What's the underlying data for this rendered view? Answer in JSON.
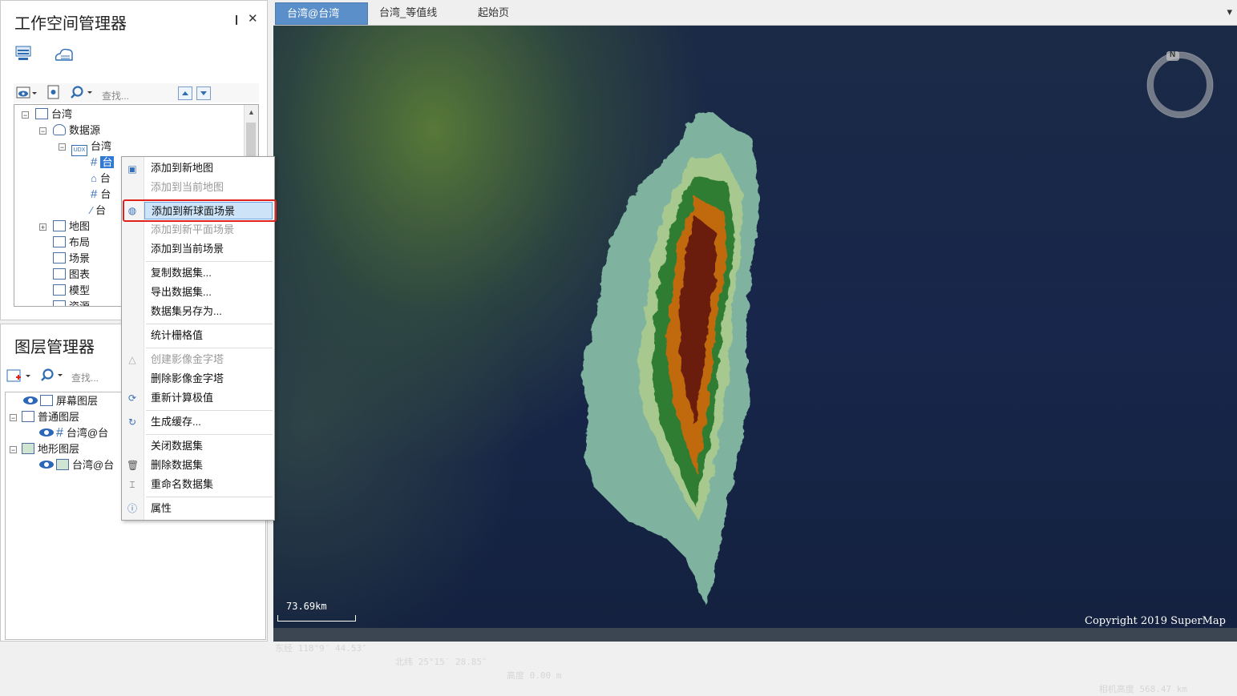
{
  "workspace_panel": {
    "title": "工作空间管理器",
    "pin_glyph": "❙",
    "close_glyph": "✕",
    "search_placeholder": "查找...",
    "tree": {
      "root": "台湾",
      "datasources": "数据源",
      "datasource_name": "台湾",
      "datasource_badge": "UDX",
      "datasets": [
        "台",
        "台",
        "台",
        "台"
      ],
      "groups": [
        "地图",
        "布局",
        "场景",
        "图表",
        "模型",
        "资源"
      ]
    }
  },
  "layer_panel": {
    "title": "图层管理器",
    "search_placeholder": "查找...",
    "tree": {
      "screen_layers": "屏幕图层",
      "normal_layers": "普通图层",
      "normal_child": "台湾@台",
      "terrain_layers": "地形图层",
      "terrain_child": "台湾@台"
    }
  },
  "tabs": [
    {
      "label": "台湾@台湾",
      "close": "✕"
    },
    {
      "label": "台湾_等值线"
    },
    {
      "label": "起始页"
    }
  ],
  "tab_dropdown": "▾",
  "scene": {
    "scale_label": "73.69km",
    "copyright": "Copyright 2019 SuperMap",
    "compass_letter": "N"
  },
  "status_bar": {
    "longitude": "东经 118°9′ 44.53″",
    "latitude": "北纬 25°15′ 28.85″",
    "altitude": "高度 0.00 m",
    "camera_height": "相机高度 568.47 km"
  },
  "context_menu": {
    "items": [
      {
        "label": "添加到新地图",
        "enabled": true
      },
      {
        "label": "添加到当前地图",
        "enabled": false
      },
      {
        "label": "添加到新球面场景",
        "enabled": true,
        "highlighted": true
      },
      {
        "label": "添加到新平面场景",
        "enabled": false
      },
      {
        "label": "添加到当前场景",
        "enabled": true
      },
      {
        "label": "复制数据集...",
        "enabled": true
      },
      {
        "label": "导出数据集...",
        "enabled": true
      },
      {
        "label": "数据集另存为...",
        "enabled": true
      },
      {
        "label": "统计栅格值",
        "enabled": true
      },
      {
        "label": "创建影像金字塔",
        "enabled": false
      },
      {
        "label": "删除影像金字塔",
        "enabled": true
      },
      {
        "label": "重新计算极值",
        "enabled": true
      },
      {
        "label": "生成缓存...",
        "enabled": true
      },
      {
        "label": "关闭数据集",
        "enabled": true
      },
      {
        "label": "删除数据集",
        "enabled": true
      },
      {
        "label": "重命名数据集",
        "enabled": true
      },
      {
        "label": "属性",
        "enabled": true
      }
    ]
  },
  "colors": {
    "tab_active": "#5a8fc9",
    "selection": "#3179d6",
    "menu_highlight": "#cde3f7",
    "annotation_red": "#e0221c",
    "terrain_low": "#7fb3a0",
    "terrain_mid": "#2e7d32",
    "terrain_high": "#c06a10",
    "terrain_peak": "#6a1a0a"
  }
}
